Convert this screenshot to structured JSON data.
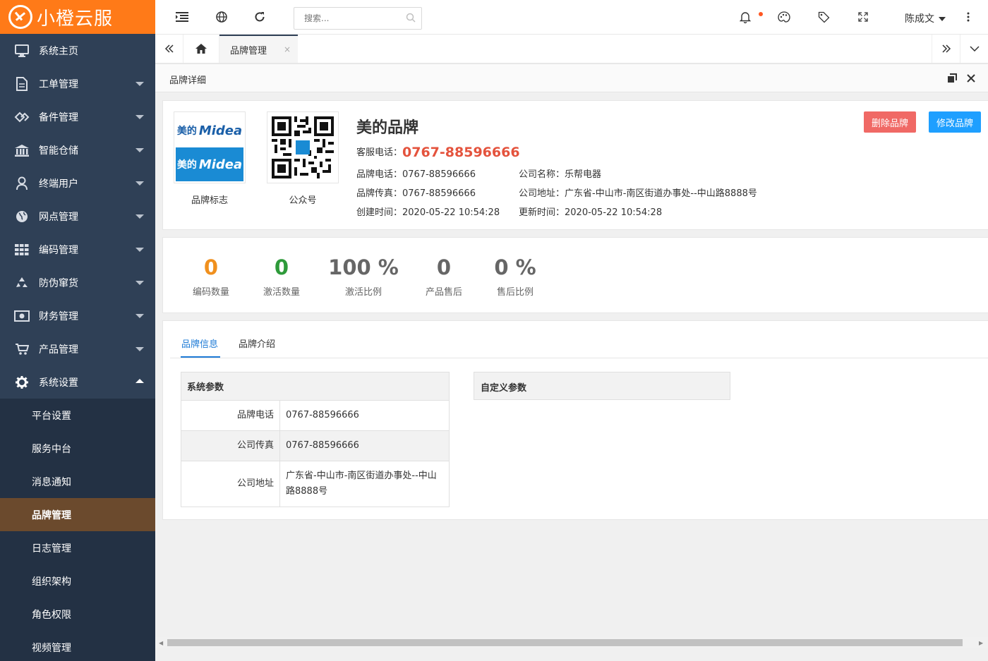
{
  "app": {
    "name": "小橙云服"
  },
  "sidebar": {
    "items": [
      {
        "label": "系统主页",
        "icon": "monitor-icon"
      },
      {
        "label": "工单管理",
        "icon": "document-icon"
      },
      {
        "label": "备件管理",
        "icon": "parts-icon"
      },
      {
        "label": "智能仓储",
        "icon": "warehouse-icon"
      },
      {
        "label": "终端用户",
        "icon": "user-icon"
      },
      {
        "label": "网点管理",
        "icon": "globe-icon"
      },
      {
        "label": "编码管理",
        "icon": "grid-icon"
      },
      {
        "label": "防伪窜货",
        "icon": "recycle-icon"
      },
      {
        "label": "财务管理",
        "icon": "money-icon"
      },
      {
        "label": "产品管理",
        "icon": "cart-icon"
      },
      {
        "label": "系统设置",
        "icon": "gear-icon"
      }
    ],
    "sub_items": [
      "平台设置",
      "服务中台",
      "消息通知",
      "品牌管理",
      "日志管理",
      "组织架构",
      "角色权限",
      "视频管理"
    ]
  },
  "header": {
    "search_placeholder": "搜索...",
    "user_name": "陈成文"
  },
  "tabs": {
    "active_label": "品牌管理",
    "close_glyph": "×"
  },
  "panel": {
    "title": "品牌详细"
  },
  "brand": {
    "name": "美的品牌",
    "logo_caption": "品牌标志",
    "qr_caption": "公众号",
    "logo_text_cn": "美的",
    "logo_text_en": "Midea",
    "hotline_label": "客服电话：",
    "hotline": "0767-88596666",
    "phone_label": "品牌电话：",
    "phone": "0767-88596666",
    "fax_label": "品牌传真：",
    "fax": "0767-88596666",
    "created_label": "创建时间：",
    "created": "2020-05-22 10:54:28",
    "company_label": "公司名称：",
    "company": "乐帮电器",
    "address_label": "公司地址：",
    "address": "广东省-中山市-南区街道办事处--中山路8888号",
    "updated_label": "更新时间：",
    "updated": "2020-05-22 10:54:28",
    "delete_label": "删除品牌",
    "edit_label": "修改品牌"
  },
  "stats": [
    {
      "value": "0",
      "label": "编码数量",
      "color": "#f0901e"
    },
    {
      "value": "0",
      "label": "激活数量",
      "color": "#2e9a3a"
    },
    {
      "value": "100 %",
      "label": "激活比例",
      "color": "#666666"
    },
    {
      "value": "0",
      "label": "产品售后",
      "color": "#666666"
    },
    {
      "value": "0 %",
      "label": "售后比例",
      "color": "#666666"
    }
  ],
  "info_tabs": [
    "品牌信息",
    "品牌介绍"
  ],
  "system_params": {
    "title": "系统参数",
    "rows": [
      {
        "key": "品牌电话",
        "value": "0767-88596666"
      },
      {
        "key": "公司传真",
        "value": "0767-88596666"
      },
      {
        "key": "公司地址",
        "value": "广东省-中山市-南区街道办事处--中山路8888号"
      }
    ]
  },
  "custom_params": {
    "title": "自定义参数"
  },
  "colors": {
    "sidebar": "#2f4056",
    "logo_bg": "#ff7a18",
    "active_sub": "#6b4a2d",
    "accent": "#1e9fff",
    "danger": "#f06965",
    "hotline": "#e4533d"
  }
}
